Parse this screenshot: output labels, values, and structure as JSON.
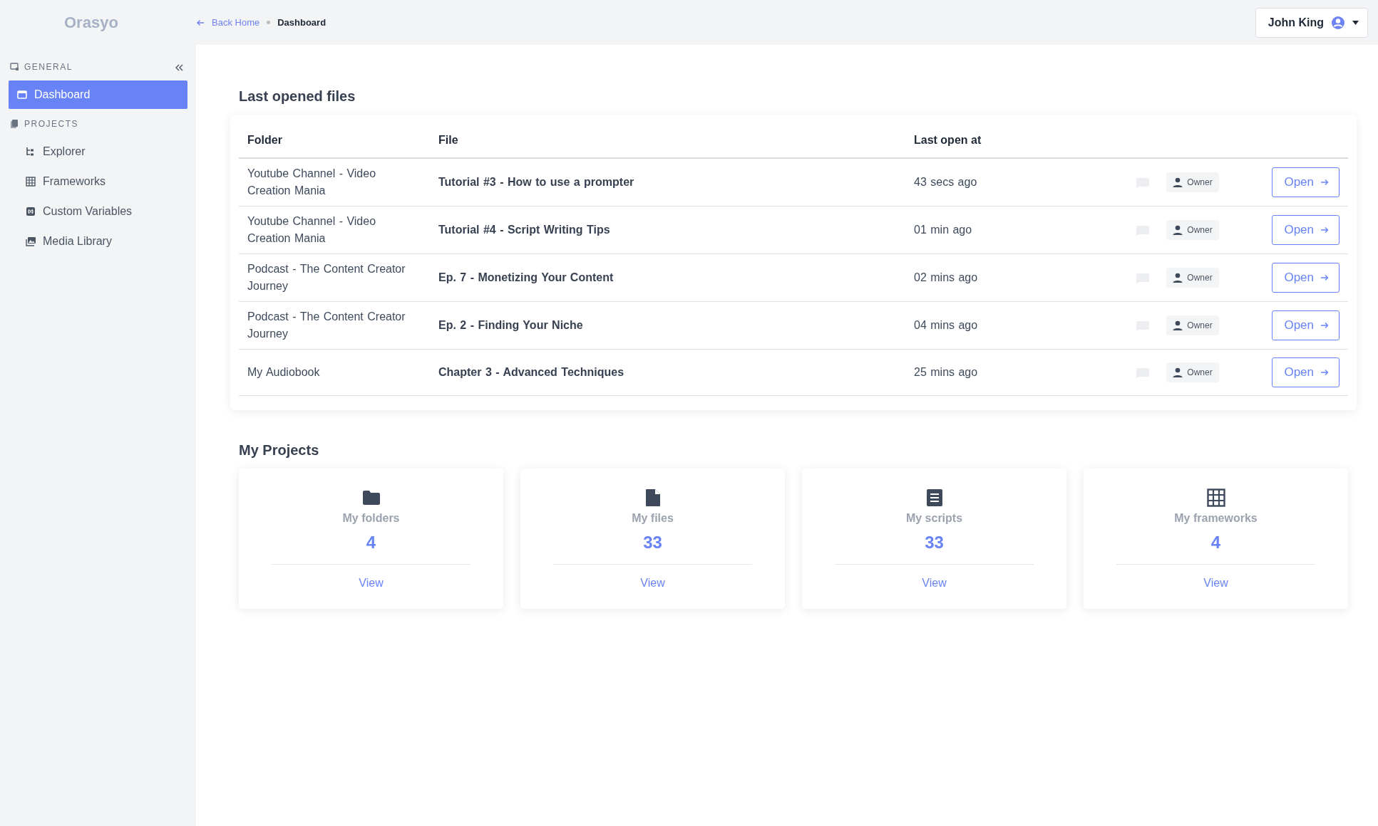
{
  "brand": {
    "name": "Orasyo"
  },
  "breadcrumb": [
    {
      "label": "Back Home",
      "kind": "link"
    },
    {
      "label": "Dashboard",
      "kind": "current"
    }
  ],
  "user": {
    "name": "John King"
  },
  "sidebar": {
    "sections": [
      {
        "title": "GENERAL",
        "kind": "general",
        "collapsible": true,
        "items": [
          {
            "label": "Dashboard",
            "kind": "dashboard",
            "selected": true
          }
        ]
      },
      {
        "title": "PROJECTS",
        "kind": "projects",
        "collapsible": false,
        "items": [
          {
            "label": "Explorer",
            "kind": "tree",
            "selected": false
          },
          {
            "label": "Frameworks",
            "kind": "grid",
            "selected": false
          },
          {
            "label": "Custom Variables",
            "kind": "variable",
            "selected": false
          },
          {
            "label": "Media Library",
            "kind": "media",
            "selected": false
          }
        ]
      }
    ]
  },
  "last_opened": {
    "title": "Last opened files",
    "columns": [
      "Folder",
      "File",
      "Last open at"
    ],
    "rows": [
      {
        "folder": "Youtube Channel - Video Creation Mania",
        "file": "Tutorial #3 - How to use a prompter",
        "opened": "43 secs ago",
        "role": "Owner",
        "action": "Open"
      },
      {
        "folder": "Youtube Channel - Video Creation Mania",
        "file": "Tutorial #4 - Script Writing Tips",
        "opened": "01 min ago",
        "role": "Owner",
        "action": "Open"
      },
      {
        "folder": "Podcast - The Content Creator Journey",
        "file": "Ep. 7 - Monetizing Your Content",
        "opened": "02 mins ago",
        "role": "Owner",
        "action": "Open"
      },
      {
        "folder": "Podcast - The Content Creator Journey",
        "file": "Ep. 2 - Finding Your Niche",
        "opened": "04 mins ago",
        "role": "Owner",
        "action": "Open"
      },
      {
        "folder": "My Audiobook",
        "file": "Chapter 3 - Advanced Techniques",
        "opened": "25 mins ago",
        "role": "Owner",
        "action": "Open"
      }
    ]
  },
  "projects": {
    "title": "My Projects",
    "cards": [
      {
        "kind": "folder",
        "label": "My folders",
        "count": "4",
        "action": "View"
      },
      {
        "kind": "file",
        "label": "My files",
        "count": "33",
        "action": "View"
      },
      {
        "kind": "script",
        "label": "My scripts",
        "count": "33",
        "action": "View"
      },
      {
        "kind": "framework",
        "label": "My frameworks",
        "count": "4",
        "action": "View"
      }
    ]
  }
}
